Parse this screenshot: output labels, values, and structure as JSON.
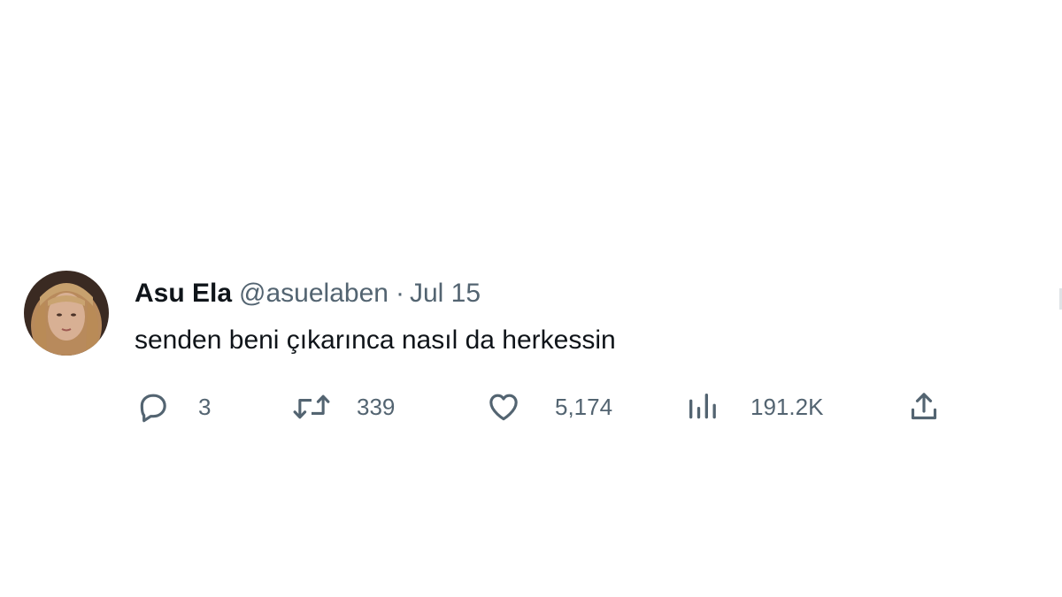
{
  "tweet": {
    "author_name": "Asu Ela",
    "handle": "@asuelaben",
    "separator": "·",
    "date": "Jul 15",
    "text": "senden beni çıkarınca nasıl da herkessin"
  },
  "actions": {
    "reply": {
      "icon": "reply-icon",
      "count": "3"
    },
    "retweet": {
      "icon": "retweet-icon",
      "count": "339"
    },
    "like": {
      "icon": "heart-icon",
      "count": "5,174"
    },
    "views": {
      "icon": "views-chart-icon",
      "count": "191.2K"
    },
    "share": {
      "icon": "share-icon"
    }
  },
  "colors": {
    "text_primary": "#0f1419",
    "text_secondary": "#536471",
    "background": "#ffffff"
  }
}
